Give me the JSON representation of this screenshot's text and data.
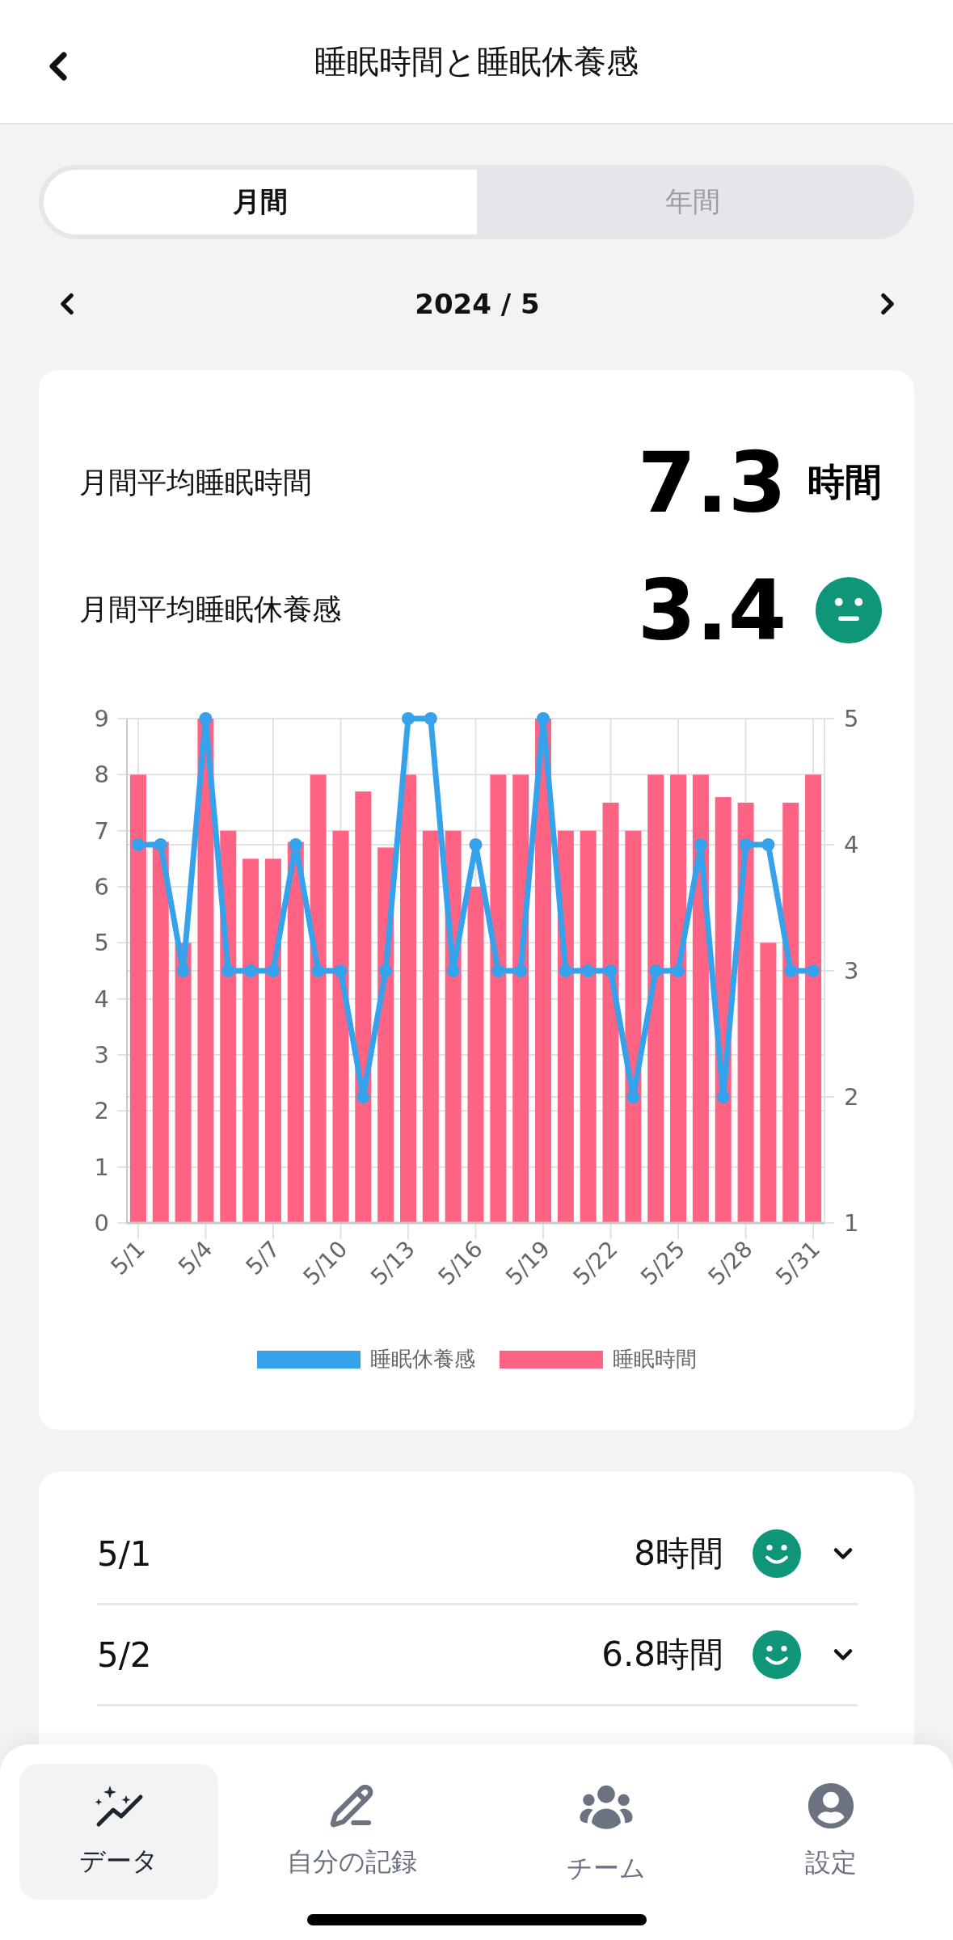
{
  "header": {
    "title": "睡眠時間と睡眠休養感"
  },
  "period_tabs": [
    {
      "label": "月間",
      "selected": true
    },
    {
      "label": "年間",
      "selected": false
    }
  ],
  "date_nav": {
    "label": "2024 / 5"
  },
  "summary": [
    {
      "label": "月間平均睡眠時間",
      "value": "7.3",
      "unit": "時間",
      "kind": "unit"
    },
    {
      "label": "月間平均睡眠休養感",
      "value": "3.4",
      "kind": "neutral"
    }
  ],
  "chart_data": {
    "type": "bar",
    "categories": [
      "5/1",
      null,
      null,
      "5/4",
      null,
      null,
      "5/7",
      null,
      null,
      "5/10",
      null,
      null,
      "5/13",
      null,
      null,
      "5/16",
      null,
      null,
      "5/19",
      null,
      null,
      "5/22",
      null,
      null,
      "5/25",
      null,
      null,
      "5/28",
      null,
      null,
      "5/31"
    ],
    "grid": true,
    "ylim": [
      0,
      9
    ],
    "yticks": [
      0,
      1,
      2,
      3,
      4,
      5,
      6,
      7,
      8,
      9
    ],
    "y2lim": [
      1,
      5
    ],
    "y2ticks": [
      1,
      2,
      3,
      4,
      5
    ],
    "series": [
      {
        "name": "睡眠休養感",
        "color": "#36a2eb",
        "type": "line",
        "marker": true,
        "axis": "y2",
        "values": [
          4,
          4,
          3,
          5,
          3,
          3,
          3,
          4,
          3,
          3,
          2,
          3,
          5,
          5,
          3,
          4,
          3,
          3,
          5,
          3,
          3,
          3,
          2,
          3,
          3,
          4,
          2,
          4,
          4,
          3,
          3
        ]
      },
      {
        "name": "睡眠時間",
        "color": "#ff6384",
        "values": [
          8,
          6.8,
          5,
          9,
          7,
          6.5,
          6.5,
          6.8,
          8,
          7,
          7.7,
          6.7,
          8,
          7,
          7,
          6,
          8,
          8,
          9,
          7,
          7,
          7.5,
          7,
          8,
          8,
          8,
          7.6,
          7.5,
          5,
          7.5,
          8
        ]
      }
    ]
  },
  "days": [
    {
      "date": "5/1",
      "hours": "8時間",
      "kind": "smile",
      "expanded": false
    },
    {
      "date": "5/2",
      "hours": "6.8時間",
      "kind": "smile",
      "expanded": false
    }
  ],
  "tab_bar": [
    {
      "label": "データ",
      "selected": true
    },
    {
      "label": "自分の記録",
      "selected": false
    },
    {
      "label": "チーム",
      "selected": false
    },
    {
      "label": "設定",
      "selected": false
    }
  ]
}
